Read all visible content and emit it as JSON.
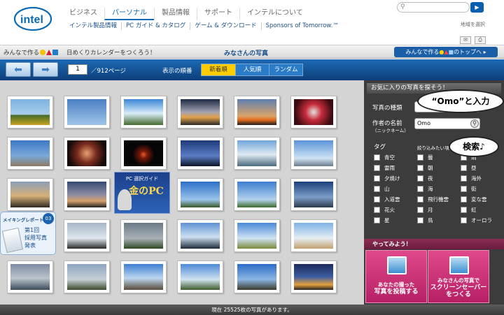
{
  "header": {
    "logo": "intel",
    "nav": [
      "ビジネス",
      "パーソナル",
      "製品情報",
      "サポート",
      "インテルについて"
    ],
    "subnav": [
      "インテル製品情報",
      "PC ガイド & カタログ",
      "ゲーム & ダウンロード",
      "Sponsors of Tomorrow.™"
    ],
    "search_placeholder": "",
    "region_link": "地域を選択",
    "icons": [
      "mail-icon",
      "print-icon"
    ]
  },
  "promo_bar": {
    "left_text": "みんなで作る",
    "left_subtext": "日めくりカレンダーをつくろう！",
    "center_title": "みなさんの写真",
    "right_button_prefix": "みんなで作る",
    "right_button_suffix": "のトップへ ▸",
    "dot_colors": [
      "#f6c100",
      "#d8202a",
      "#1e7fd0"
    ]
  },
  "toolbar": {
    "page_current": "1",
    "page_total": "／912ページ",
    "order_label": "表示の順番",
    "orders": [
      "新着順",
      "人気順",
      "ランダム"
    ]
  },
  "promos": {
    "pc_guide_title": "PC 選択ガイド",
    "pc_guide_main": "金のPC",
    "making_header": "メイキングレポート",
    "making_number": "03",
    "making_body": [
      "第1回",
      "採用写真",
      "発表"
    ]
  },
  "sidebar": {
    "heading": "お気に入りの写真を探そう！",
    "type_label": "写真の種類",
    "type_value": "",
    "author_label": "作者の名前",
    "author_sub": "（ニックネーム）",
    "author_value": "Omo",
    "tag_label": "タグ",
    "tag_hint": "絞り込みたい項目を",
    "tags": [
      "青空",
      "曇",
      "雨",
      "雷雨",
      "朝",
      "昼",
      "夕焼け",
      "夜",
      "海外",
      "山",
      "海",
      "街",
      "入道雲",
      "飛行機雲",
      "変な雲",
      "花火",
      "月",
      "虹",
      "星",
      "鳥",
      "オーロラ"
    ],
    "try_heading": "やってみよう！",
    "try_buttons": [
      {
        "line1": "あなたの撮った",
        "line2": "写真を投稿する"
      },
      {
        "line1": "みなさんの写真で",
        "line2": "スクリーンセーバー",
        "line3": "をつくる"
      }
    ]
  },
  "annotations": {
    "bubble1": "“Omo”と入力",
    "bubble2": "検索♪"
  },
  "footer": {
    "text": "現在 25525枚の写真があります。"
  }
}
